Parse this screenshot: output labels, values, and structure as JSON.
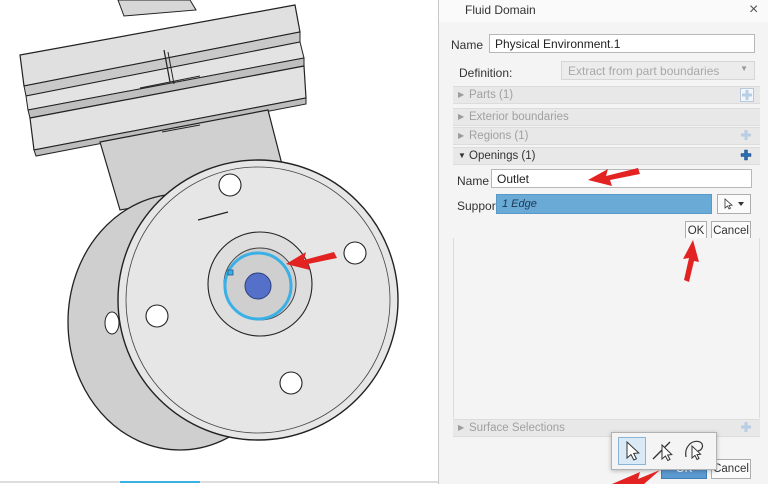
{
  "dialog": {
    "title": "Fluid Domain",
    "close_glyph": "×",
    "name_label": "Name",
    "name_value": "Physical Environment.1",
    "definition_label": "Definition:",
    "definition_value": "Extract from part boundaries",
    "sections": {
      "parts": "Parts (1)",
      "exterior": "Exterior boundaries",
      "regions": "Regions (1)",
      "openings": "Openings (1)",
      "surface": "Surface Selections"
    },
    "opening": {
      "name_label": "Name",
      "name_value": "Outlet",
      "support_label": "Support",
      "support_value": "1 Edge",
      "ok_label": "OK",
      "cancel_label": "Cancel"
    },
    "footer": {
      "ok_label": "OK",
      "cancel_label": "Cancel"
    }
  },
  "selection_toolbar": {
    "tools": [
      "select-arrow-icon",
      "edge-select-icon",
      "lasso-select-icon"
    ]
  },
  "colors": {
    "accent_blue": "#6aaad6",
    "highlight_edge": "#3ab0e6",
    "annotation_red": "#e32222",
    "plus_blue": "#2b6cb0"
  }
}
